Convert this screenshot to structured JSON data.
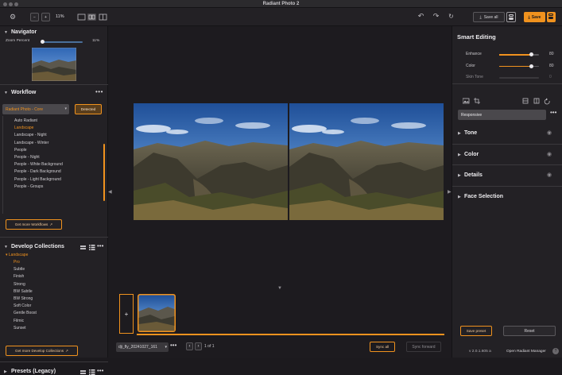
{
  "app": {
    "title": "Radiant Photo 2"
  },
  "toolbar": {
    "zoom_value": "11%",
    "save_all_label": "Save all",
    "save_label": "Save"
  },
  "navigator": {
    "title": "Navigator",
    "zoom_label": "Zoom Percent",
    "zoom_value": "11%",
    "zoom_level": 0.11
  },
  "workflow": {
    "title": "Workflow",
    "selected_preset": "Radiant Photo - Core",
    "detected_label": "Detected",
    "items": [
      {
        "label": "Auto Radiant",
        "selected": false
      },
      {
        "label": "Landscape",
        "selected": true
      },
      {
        "label": "Landscape - Night",
        "selected": false
      },
      {
        "label": "Landscape - Winter",
        "selected": false
      },
      {
        "label": "People",
        "selected": false
      },
      {
        "label": "People - Night",
        "selected": false
      },
      {
        "label": "People - White Background",
        "selected": false
      },
      {
        "label": "People - Dark Background",
        "selected": false
      },
      {
        "label": "People - Light Background",
        "selected": false
      },
      {
        "label": "People - Groups",
        "selected": false
      }
    ],
    "get_more_label": "Get more Workflows"
  },
  "develop": {
    "title": "Develop Collections",
    "group_label": "Landscape",
    "items": [
      {
        "label": "Pro",
        "selected": true
      },
      {
        "label": "Subtle",
        "selected": false
      },
      {
        "label": "Finish",
        "selected": false
      },
      {
        "label": "Strong",
        "selected": false
      },
      {
        "label": "BW Subtle",
        "selected": false
      },
      {
        "label": "BW Strong",
        "selected": false
      },
      {
        "label": "Soft Color",
        "selected": false
      },
      {
        "label": "Gentle Boost",
        "selected": false
      },
      {
        "label": "Filmic",
        "selected": false
      },
      {
        "label": "Sunset",
        "selected": false
      }
    ],
    "get_more_label": "Get more Develop Collections"
  },
  "presets": {
    "title": "Presets (Legacy)"
  },
  "filmstrip": {
    "filename": "dji_fly_20241027_161",
    "page_current": "1",
    "page_of": "of 1",
    "sync_all_label": "Sync all",
    "sync_forward_label": "Sync forward"
  },
  "smart": {
    "title": "Smart Editing",
    "sliders": [
      {
        "label": "Enhance",
        "value": "80",
        "level": 0.8,
        "enabled": true
      },
      {
        "label": "Color",
        "value": "80",
        "level": 0.8,
        "enabled": true
      },
      {
        "label": "Skin Tone",
        "value": "0",
        "level": 0.0,
        "enabled": false
      }
    ],
    "preset_name": "Responsive",
    "sections": [
      "Tone",
      "Color",
      "Details",
      "Face Selection"
    ],
    "save_preset_label": "Save preset",
    "reset_label": "Reset",
    "version": "v 2.0.1.605 a",
    "open_manager_label": "Open Radiant Manager"
  },
  "colors": {
    "accent": "#f0921e",
    "panel": "#232125",
    "canvas": "#1d1b1f"
  }
}
